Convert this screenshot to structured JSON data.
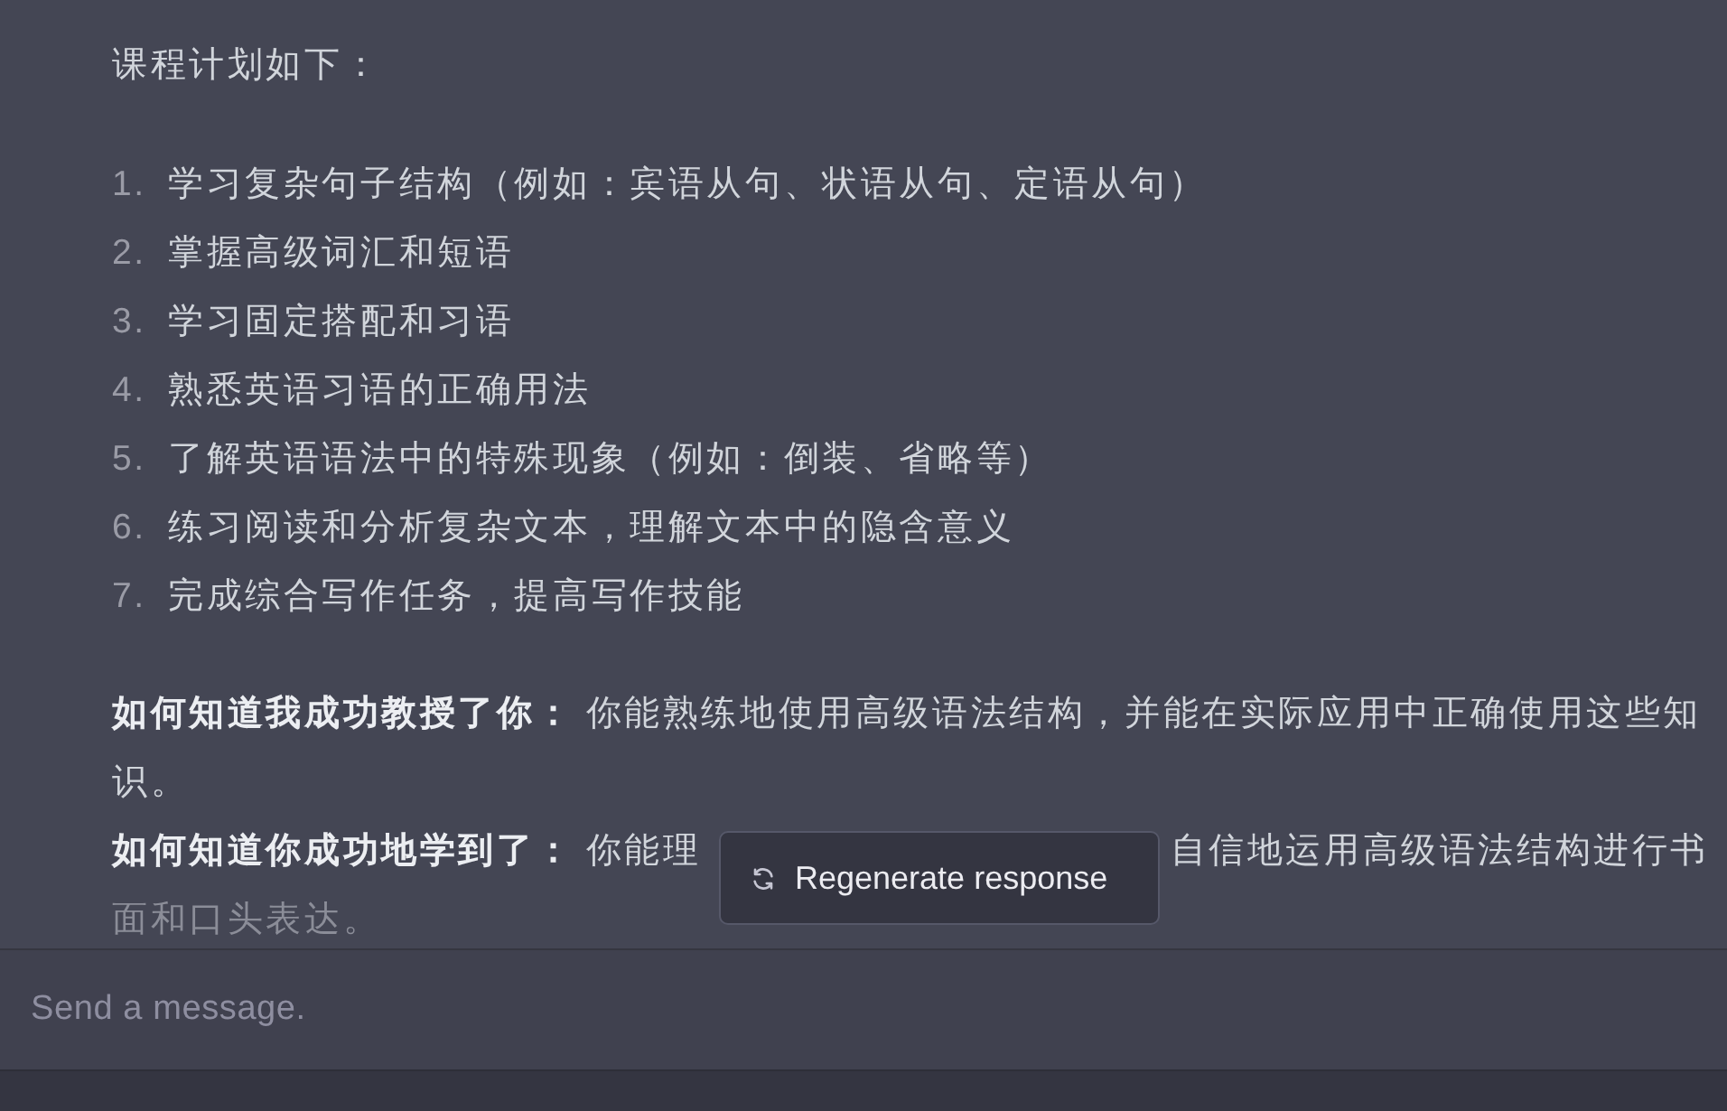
{
  "message": {
    "intro": "课程计划如下：",
    "plan": [
      "学习复杂句子结构（例如：宾语从句、状语从句、定语从句）",
      "掌握高级词汇和短语",
      "学习固定搭配和习语",
      "熟悉英语习语的正确用法",
      "了解英语语法中的特殊现象（例如：倒装、省略等）",
      "练习阅读和分析复杂文本，理解文本中的隐含意义",
      "完成综合写作任务，提高写作技能"
    ],
    "plan_numbers": [
      "1.",
      "2.",
      "3.",
      "4.",
      "5.",
      "6.",
      "7."
    ],
    "paragraphs": [
      {
        "text": "**如何知道我成功教授了你：** 你能熟练地使用高级语法结构，并能在实际应用中正确使用这些知识。"
      },
      {
        "text": "**如何知道你成功地学到了：** 你能理",
        "text_after_overlay": "自信地运用高级语法结构进行书",
        "next_line": "面和口头表达。"
      }
    ]
  },
  "regenerate_button": {
    "label": "Regenerate response"
  },
  "composer": {
    "placeholder": "Send a message."
  }
}
